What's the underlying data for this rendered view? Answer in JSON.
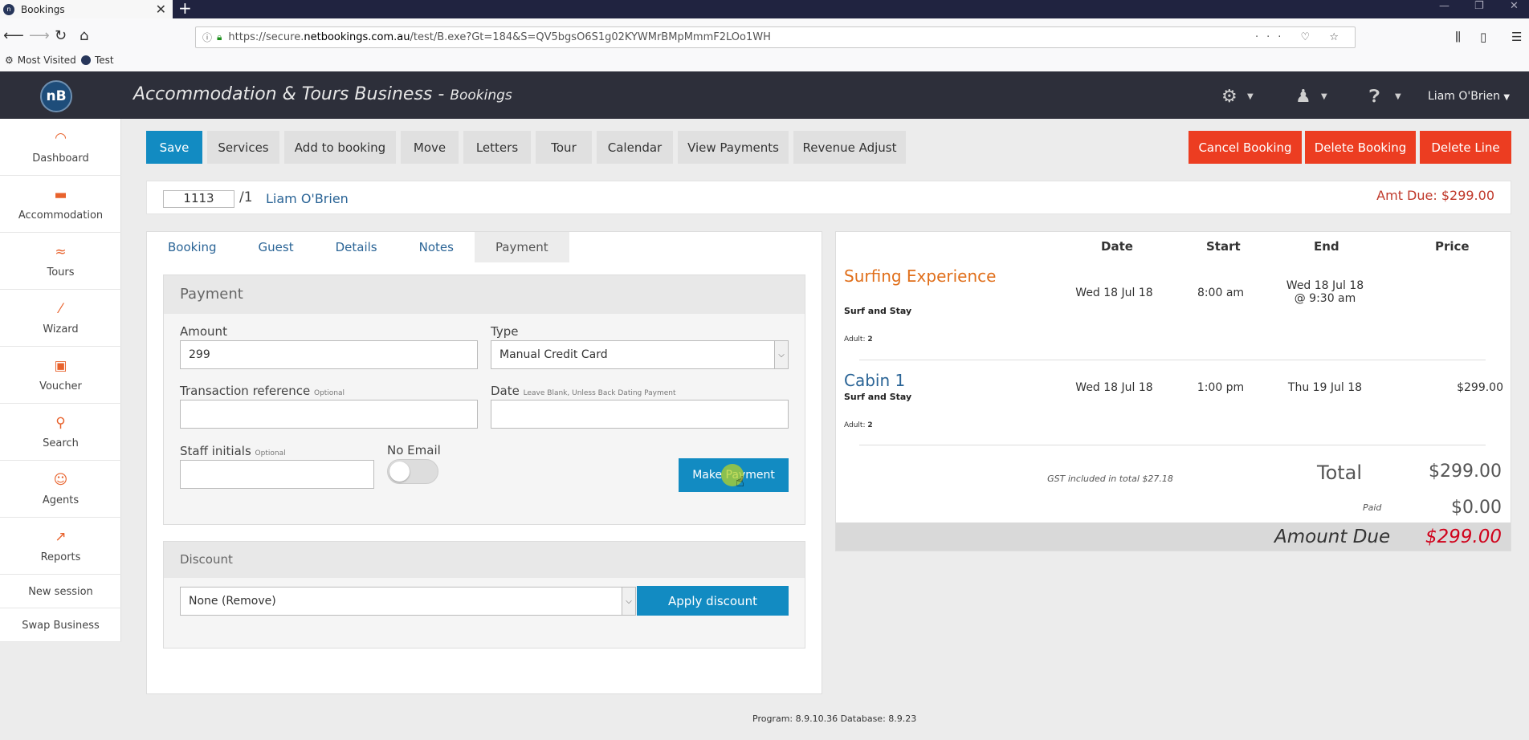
{
  "browser": {
    "tab_title": "Bookings",
    "tab_close": "✕",
    "new_tab": "+",
    "url_prefix": "https://secure.",
    "url_domain": "netbookings.com.au",
    "url_path": "/test/B.exe?Gt=184&S=QV5bgsO6S1g02KYWMrBMpMmmF2LOo1WH",
    "bookmarks": [
      "Most Visited",
      "Test"
    ]
  },
  "app": {
    "logo_text": "nB",
    "title": "Accommodation & Tours Business - ",
    "subtitle": "Bookings",
    "user": "Liam O'Brien"
  },
  "sidebar": {
    "items": [
      {
        "label": "Dashboard",
        "icon": "gauge-icon"
      },
      {
        "label": "Accommodation",
        "icon": "bed-icon"
      },
      {
        "label": "Tours",
        "icon": "swimmer-icon"
      },
      {
        "label": "Wizard",
        "icon": "magic-wand-icon"
      },
      {
        "label": "Voucher",
        "icon": "gift-icon"
      },
      {
        "label": "Search",
        "icon": "search-icon"
      },
      {
        "label": "Agents",
        "icon": "agent-icon"
      },
      {
        "label": "Reports",
        "icon": "chart-icon"
      },
      {
        "label": "New session"
      },
      {
        "label": "Swap Business"
      }
    ]
  },
  "toolbar": {
    "save": "Save",
    "services": "Services",
    "add_to_booking": "Add to booking",
    "move": "Move",
    "letters": "Letters",
    "tour": "Tour",
    "calendar": "Calendar",
    "view_payments": "View Payments",
    "revenue_adjust": "Revenue Adjust",
    "cancel_booking": "Cancel Booking",
    "delete_booking": "Delete Booking",
    "delete_line": "Delete Line"
  },
  "booking": {
    "number": "1113",
    "line": "/1",
    "guest_name": "Liam O'Brien",
    "amount_due_label": "Amt Due: $299.00"
  },
  "tabs": [
    "Booking",
    "Guest",
    "Details",
    "Notes",
    "Payment"
  ],
  "payment": {
    "heading": "Payment",
    "amount_label": "Amount",
    "amount_value": "299",
    "type_label": "Type",
    "type_value": "Manual Credit Card",
    "txref_label": "Transaction reference",
    "txref_hint": "Optional",
    "date_label": "Date",
    "date_hint": "Leave Blank, Unless Back Dating Payment",
    "staff_label": "Staff initials",
    "staff_hint": "Optional",
    "no_email_label": "No Email",
    "make_payment": "Make Payment"
  },
  "discount": {
    "heading": "Discount",
    "selected": "None (Remove)",
    "apply": "Apply discount"
  },
  "summary": {
    "headers": {
      "date": "Date",
      "start": "Start",
      "end": "End",
      "price": "Price"
    },
    "items": [
      {
        "name": "Surfing Experience",
        "sub": "Surf and Stay",
        "adult_label": "Adult:",
        "adults": "2",
        "date": "Wed 18 Jul 18",
        "start": "8:00 am",
        "end_line1": "Wed 18 Jul 18",
        "end_line2": "@ 9:30 am",
        "price": ""
      },
      {
        "name": "Cabin 1",
        "sub": "Surf and Stay",
        "adult_label": "Adult:",
        "adults": "2",
        "date": "Wed 18 Jul 18",
        "start": "1:00 pm",
        "end_line1": "Thu 19 Jul 18",
        "end_line2": "",
        "price": "$299.00"
      }
    ],
    "gst": "GST included in total $27.18",
    "total_label": "Total",
    "total_value": "$299.00",
    "paid_label": "Paid",
    "paid_value": "$0.00",
    "due_label": "Amount Due",
    "due_value": "$299.00"
  },
  "footer": "Program: 8.9.10.36 Database: 8.9.23"
}
